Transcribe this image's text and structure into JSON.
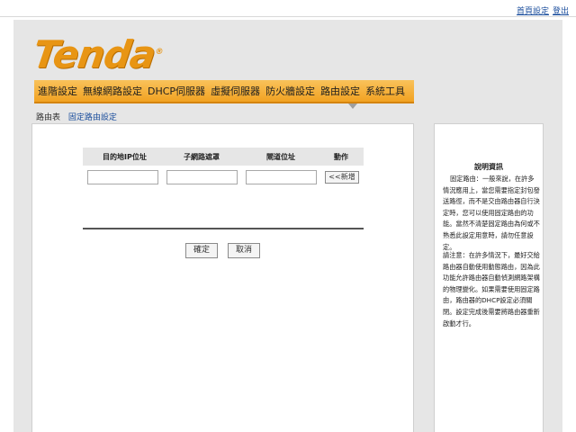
{
  "top_links": {
    "home": "首頁設定",
    "logout": "登出"
  },
  "logo": {
    "text": "Tenda",
    "mark": "®"
  },
  "nav": {
    "items": [
      "進階設定",
      "無線網路設定",
      "DHCP伺服器",
      "虛擬伺服器",
      "防火牆設定",
      "路由設定",
      "系統工具"
    ]
  },
  "subnav": {
    "items": [
      "路由表",
      "固定路由設定"
    ]
  },
  "table": {
    "headers": [
      "目的地IP位址",
      "子網路遮罩",
      "閘道位址",
      "動作"
    ],
    "add_label": "<<新增",
    "dest_ip": "",
    "netmask": "",
    "gateway": ""
  },
  "buttons": {
    "ok": "確定",
    "cancel": "取消"
  },
  "help": {
    "title": "說明資訊",
    "para1": "固定路由：一般來說，在許多情況應用上，當您需要指定封包發送路徑，而不是交由路由器自行決定時，您可以使用固定路由的功能。當然不清楚固定路由為何或不熟悉此設定用意時，請勿任意設定。",
    "para2": "請注意：在許多情況下，最好交給路由器自動使用動態路由，因為此功能允許路由器自動偵測網路架構的物理變化。如果需要使用固定路由，路由器的DHCP設定必須關閉。設定完成後需要將路由器重新啟動才行。"
  }
}
